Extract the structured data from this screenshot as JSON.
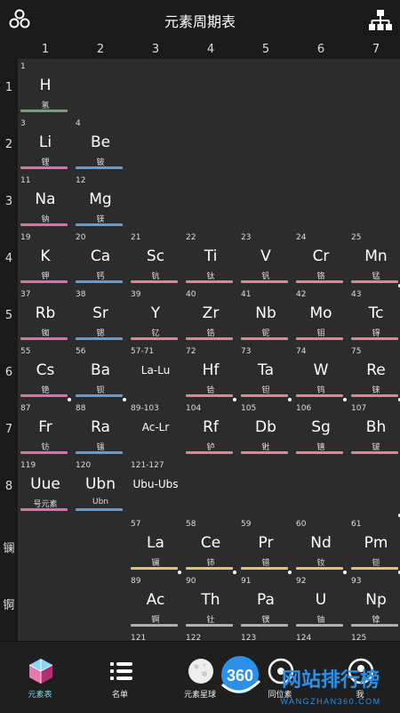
{
  "app": {
    "title": "元素周期表",
    "left_icon": "atom-dots-icon",
    "right_icon": "hierarchy-icon"
  },
  "columns": [
    "1",
    "2",
    "3",
    "4",
    "5",
    "6",
    "7"
  ],
  "rows": [
    "1",
    "2",
    "3",
    "4",
    "5",
    "6",
    "7",
    "8",
    "镧",
    "锕"
  ],
  "colors": {
    "H": "#6aa86d",
    "alkali": "#e56bb0",
    "alkaline": "#5a9ee0",
    "transition": "#e8838c",
    "lanthanide": "#e8c26a",
    "actinide": "#b0b0b0",
    "background": "#2c2c2c",
    "accent": "#7ad8e8"
  },
  "elements": [
    {
      "num": "1",
      "sym": "H",
      "cn": "氢",
      "row": 0,
      "col": 0,
      "color": "#6aa86d"
    },
    {
      "num": "3",
      "sym": "Li",
      "cn": "锂",
      "row": 1,
      "col": 0,
      "color": "#e56bb0"
    },
    {
      "num": "4",
      "sym": "Be",
      "cn": "铍",
      "row": 1,
      "col": 1,
      "color": "#5a9ee0"
    },
    {
      "num": "11",
      "sym": "Na",
      "cn": "钠",
      "row": 2,
      "col": 0,
      "color": "#e56bb0"
    },
    {
      "num": "12",
      "sym": "Mg",
      "cn": "镁",
      "row": 2,
      "col": 1,
      "color": "#5a9ee0"
    },
    {
      "num": "19",
      "sym": "K",
      "cn": "钾",
      "row": 3,
      "col": 0,
      "color": "#e56bb0"
    },
    {
      "num": "20",
      "sym": "Ca",
      "cn": "钙",
      "row": 3,
      "col": 1,
      "color": "#5a9ee0"
    },
    {
      "num": "21",
      "sym": "Sc",
      "cn": "钪",
      "row": 3,
      "col": 2,
      "color": "#e8838c"
    },
    {
      "num": "22",
      "sym": "Ti",
      "cn": "钛",
      "row": 3,
      "col": 3,
      "color": "#e8838c"
    },
    {
      "num": "23",
      "sym": "V",
      "cn": "钒",
      "row": 3,
      "col": 4,
      "color": "#e8838c"
    },
    {
      "num": "24",
      "sym": "Cr",
      "cn": "铬",
      "row": 3,
      "col": 5,
      "color": "#e8838c"
    },
    {
      "num": "25",
      "sym": "Mn",
      "cn": "锰",
      "row": 3,
      "col": 6,
      "color": "#e8838c"
    },
    {
      "num": "37",
      "sym": "Rb",
      "cn": "铷",
      "row": 4,
      "col": 0,
      "color": "#e56bb0"
    },
    {
      "num": "38",
      "sym": "Sr",
      "cn": "锶",
      "row": 4,
      "col": 1,
      "color": "#5a9ee0"
    },
    {
      "num": "39",
      "sym": "Y",
      "cn": "钇",
      "row": 4,
      "col": 2,
      "color": "#e8838c"
    },
    {
      "num": "40",
      "sym": "Zr",
      "cn": "锆",
      "row": 4,
      "col": 3,
      "color": "#e8838c"
    },
    {
      "num": "41",
      "sym": "Nb",
      "cn": "铌",
      "row": 4,
      "col": 4,
      "color": "#e8838c"
    },
    {
      "num": "42",
      "sym": "Mo",
      "cn": "钼",
      "row": 4,
      "col": 5,
      "color": "#e8838c"
    },
    {
      "num": "43",
      "sym": "Tc",
      "cn": "锝",
      "row": 4,
      "col": 6,
      "color": "#e8838c",
      "dot": true
    },
    {
      "num": "55",
      "sym": "Cs",
      "cn": "铯",
      "row": 5,
      "col": 0,
      "color": "#e56bb0"
    },
    {
      "num": "56",
      "sym": "Ba",
      "cn": "钡",
      "row": 5,
      "col": 1,
      "color": "#5a9ee0"
    },
    {
      "num": "72",
      "sym": "Hf",
      "cn": "铪",
      "row": 5,
      "col": 3,
      "color": "#e8838c"
    },
    {
      "num": "73",
      "sym": "Ta",
      "cn": "钽",
      "row": 5,
      "col": 4,
      "color": "#e8838c"
    },
    {
      "num": "74",
      "sym": "W",
      "cn": "钨",
      "row": 5,
      "col": 5,
      "color": "#e8838c"
    },
    {
      "num": "75",
      "sym": "Re",
      "cn": "铼",
      "row": 5,
      "col": 6,
      "color": "#e8838c"
    },
    {
      "num": "87",
      "sym": "Fr",
      "cn": "钫",
      "row": 6,
      "col": 0,
      "color": "#e56bb0",
      "dot": true
    },
    {
      "num": "88",
      "sym": "Ra",
      "cn": "镭",
      "row": 6,
      "col": 1,
      "color": "#5a9ee0",
      "dot": true
    },
    {
      "num": "104",
      "sym": "Rf",
      "cn": "𬬻",
      "row": 6,
      "col": 3,
      "color": "#e8838c",
      "dot": true
    },
    {
      "num": "105",
      "sym": "Db",
      "cn": "𬭊",
      "row": 6,
      "col": 4,
      "color": "#e8838c",
      "dot": true
    },
    {
      "num": "106",
      "sym": "Sg",
      "cn": "𬭳",
      "row": 6,
      "col": 5,
      "color": "#e8838c",
      "dot": true
    },
    {
      "num": "107",
      "sym": "Bh",
      "cn": "𬭛",
      "row": 6,
      "col": 6,
      "color": "#e8838c",
      "dot": true
    },
    {
      "num": "119",
      "sym": "Uue",
      "cn": "号元素",
      "row": 7,
      "col": 0,
      "color": "#e56bb0"
    },
    {
      "num": "120",
      "sym": "Ubn",
      "cn": "Ubn",
      "row": 7,
      "col": 1,
      "color": "#5a9ee0"
    },
    {
      "num": "57",
      "sym": "La",
      "cn": "镧",
      "row": 8,
      "col": 2,
      "color": "#e8c26a"
    },
    {
      "num": "58",
      "sym": "Ce",
      "cn": "铈",
      "row": 8,
      "col": 3,
      "color": "#e8c26a"
    },
    {
      "num": "59",
      "sym": "Pr",
      "cn": "镨",
      "row": 8,
      "col": 4,
      "color": "#e8c26a"
    },
    {
      "num": "60",
      "sym": "Nd",
      "cn": "钕",
      "row": 8,
      "col": 5,
      "color": "#e8c26a"
    },
    {
      "num": "61",
      "sym": "Pm",
      "cn": "钷",
      "row": 8,
      "col": 6,
      "color": "#e8c26a",
      "dot": true
    },
    {
      "num": "89",
      "sym": "Ac",
      "cn": "锕",
      "row": 9,
      "col": 2,
      "color": "#b0b0b0",
      "dot": true
    },
    {
      "num": "90",
      "sym": "Th",
      "cn": "钍",
      "row": 9,
      "col": 3,
      "color": "#b0b0b0",
      "dot": true
    },
    {
      "num": "91",
      "sym": "Pa",
      "cn": "镤",
      "row": 9,
      "col": 4,
      "color": "#b0b0b0",
      "dot": true
    },
    {
      "num": "92",
      "sym": "U",
      "cn": "铀",
      "row": 9,
      "col": 5,
      "color": "#b0b0b0",
      "dot": true
    },
    {
      "num": "93",
      "sym": "Np",
      "cn": "镎",
      "row": 9,
      "col": 6,
      "color": "#b0b0b0",
      "dot": true
    },
    {
      "num": "121",
      "sym": "",
      "cn": "",
      "row": 10,
      "col": 2,
      "color": ""
    },
    {
      "num": "122",
      "sym": "",
      "cn": "",
      "row": 10,
      "col": 3,
      "color": ""
    },
    {
      "num": "123",
      "sym": "",
      "cn": "",
      "row": 10,
      "col": 4,
      "color": ""
    },
    {
      "num": "124",
      "sym": "",
      "cn": "",
      "row": 10,
      "col": 5,
      "color": ""
    },
    {
      "num": "125",
      "sym": "",
      "cn": "",
      "row": 10,
      "col": 6,
      "color": ""
    }
  ],
  "ranges": [
    {
      "num": "57-71",
      "label": "La-Lu",
      "row": 5,
      "col": 2
    },
    {
      "num": "89-103",
      "label": "Ac-Lr",
      "row": 6,
      "col": 2
    },
    {
      "num": "121-127",
      "label": "Ubu-Ubs",
      "row": 7,
      "col": 2
    }
  ],
  "bottom_nav": [
    {
      "label": "元素表",
      "icon": "polyhedron-icon",
      "active": true
    },
    {
      "label": "名单",
      "icon": "list-icon",
      "active": false
    },
    {
      "label": "元素星球",
      "icon": "planet-icon",
      "active": false
    },
    {
      "label": "同位素",
      "icon": "isotope-icon",
      "active": false
    },
    {
      "label": "我",
      "icon": "user-icon",
      "active": false
    }
  ],
  "watermark": {
    "badge": "360",
    "main": "网站排行榜",
    "sub": "WANGZHAN360.COM"
  }
}
